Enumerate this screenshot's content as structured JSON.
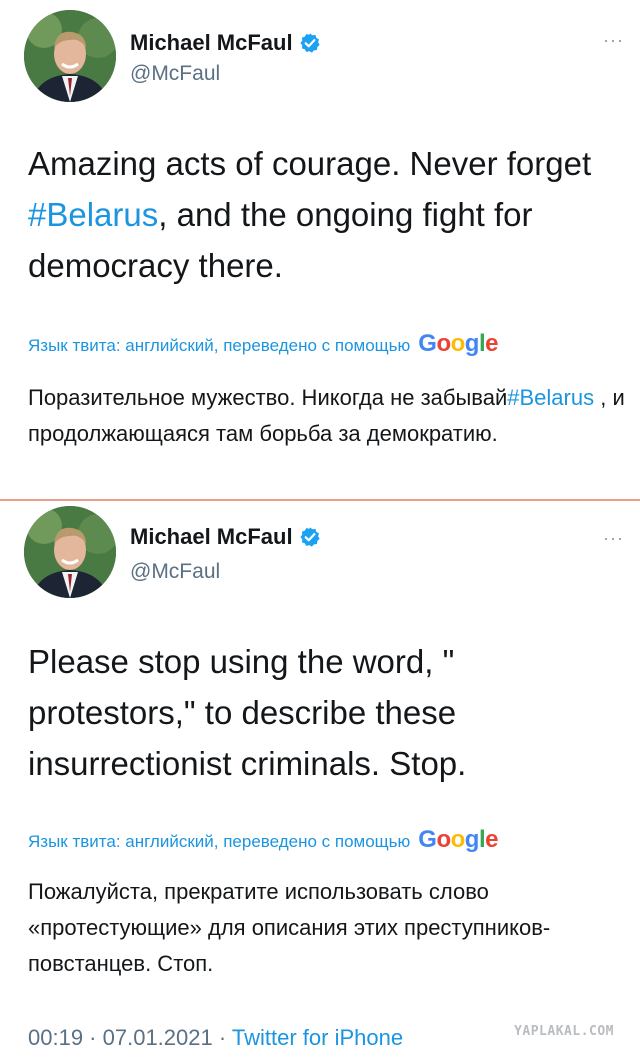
{
  "tweets": [
    {
      "author": {
        "name": "Michael McFaul",
        "handle": "@McFaul"
      },
      "more_label": "···",
      "text_before": "Amazing acts of courage. Never forget ",
      "hashtag": "#Belarus",
      "text_after": ", and the ongoing fight for democracy there.",
      "translation_note": "Язык твита: английский, переведено с помощью",
      "translation_before": "Поразительное мужество. Никогда не забывай",
      "translation_hashtag": "#Belarus",
      "translation_after": " , и продолжающаяся там борьба за демократию."
    },
    {
      "author": {
        "name": "Michael McFaul",
        "handle": "@McFaul"
      },
      "more_label": "···",
      "text": "Please stop using the word, \" protestors,\" to describe these insurrectionist criminals. Stop.",
      "translation_note": "Язык твита: английский, переведено с помощью",
      "translation": "Пожалуйста, прекратите использовать слово «протестующие» для описания этих преступников-повстанцев. Стоп."
    }
  ],
  "google_logo": {
    "g1": "G",
    "o1": "o",
    "o2": "o",
    "g2": "g",
    "l": "l",
    "e": "e"
  },
  "meta": {
    "time": "00:19",
    "dot": " · ",
    "date": "07.01.2021",
    "source": "Twitter for iPhone"
  },
  "watermark": "YAPLAKAL.COM",
  "colors": {
    "link": "#1b95e0",
    "secondary": "#5b7083",
    "verified": "#1da1f2",
    "divider": "#e9a08a"
  }
}
